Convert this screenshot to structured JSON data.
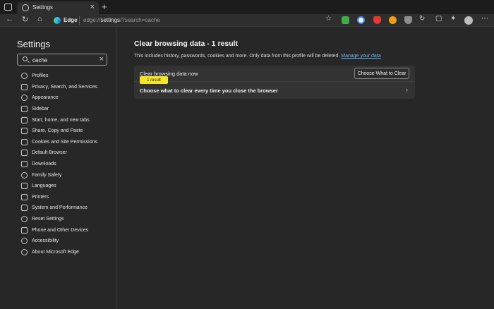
{
  "tab": {
    "title": "Settings",
    "close": "×",
    "new_tab": "+"
  },
  "toolbar": {
    "back": "←",
    "refresh": "↻",
    "home": "⌂",
    "brand": "Edge",
    "url_prefix": "edge://",
    "url_bold": "settings",
    "url_suffix": "/?search=cache",
    "icons": [
      "favorites-add-icon",
      "extension-green-icon",
      "extension-google-icon",
      "extension-red-icon",
      "extension-orange-icon",
      "extension-shield-icon",
      "refresh-extension-icon",
      "split-screen-icon",
      "favorites-icon",
      "collections-icon",
      "profile-icon"
    ]
  },
  "sidebar": {
    "title": "Settings",
    "search_value": "cache",
    "search_clear": "×",
    "items": [
      {
        "label": "Profiles",
        "icon": "profile-icon"
      },
      {
        "label": "Privacy, Search, and Services",
        "icon": "lock-icon"
      },
      {
        "label": "Appearance",
        "icon": "palette-icon"
      },
      {
        "label": "Sidebar",
        "icon": "sidebar-icon"
      },
      {
        "label": "Start, home, and new tabs",
        "icon": "home-icon"
      },
      {
        "label": "Share, Copy and Paste",
        "icon": "share-icon"
      },
      {
        "label": "Cookies and Site Permissions",
        "icon": "cookie-icon"
      },
      {
        "label": "Default Browser",
        "icon": "browser-icon"
      },
      {
        "label": "Downloads",
        "icon": "download-icon"
      },
      {
        "label": "Family Safety",
        "icon": "family-icon"
      },
      {
        "label": "Languages",
        "icon": "language-icon"
      },
      {
        "label": "Printers",
        "icon": "printer-icon"
      },
      {
        "label": "System and Performance",
        "icon": "system-icon"
      },
      {
        "label": "Reset Settings",
        "icon": "reset-icon"
      },
      {
        "label": "Phone and Other Devices",
        "icon": "phone-icon"
      },
      {
        "label": "Accessibility",
        "icon": "accessibility-icon"
      },
      {
        "label": "About Microsoft Edge",
        "icon": "edge-icon"
      }
    ]
  },
  "main": {
    "heading": "Clear browsing data - 1 result",
    "description": "This includes history, passwords, cookies and more. Only data from this profile will be deleted.",
    "manage_link": "Manage your data",
    "row1_label": "Clear browsing data now",
    "row1_button": "Choose What to Clear",
    "badge": "1 result",
    "row2_label": "Choose what to clear every time you close the browser",
    "row2_chevron": "›"
  },
  "colors": {
    "background": "#272727",
    "tabstrip": "#1c1c1c",
    "card": "#333333",
    "badge": "#f3e62a",
    "link": "#6ab7ff"
  }
}
